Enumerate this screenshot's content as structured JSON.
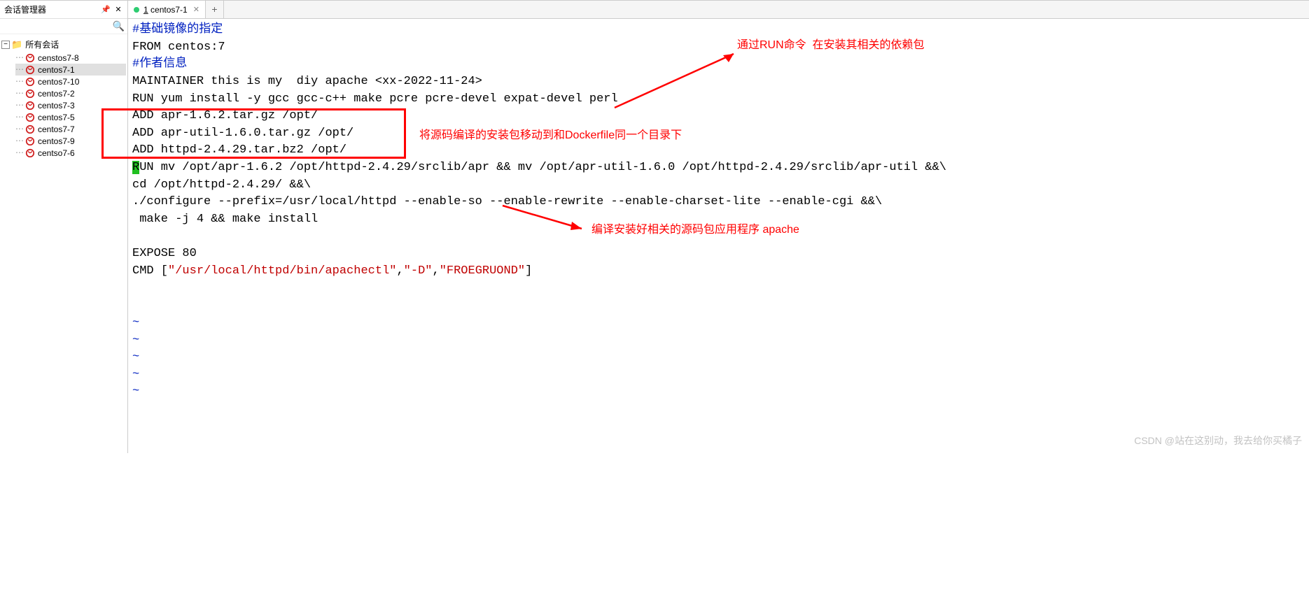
{
  "sidebar": {
    "title": "会话管理器",
    "root_label": "所有会话",
    "items": [
      {
        "label": "censtos7-8"
      },
      {
        "label": "centos7-1"
      },
      {
        "label": "centos7-10"
      },
      {
        "label": "centos7-2"
      },
      {
        "label": "centos7-3"
      },
      {
        "label": "centos7-5"
      },
      {
        "label": "centos7-7"
      },
      {
        "label": "centos7-9"
      },
      {
        "label": "centso7-6"
      }
    ]
  },
  "tabs": {
    "active_num": "1",
    "active_label": "centos7-1",
    "add": "+"
  },
  "code": {
    "l1": "#基础镜像的指定",
    "l2": "FROM centos:7",
    "l3": "#作者信息",
    "l4": "MAINTAINER this is my  diy apache <xx-2022-11-24>",
    "l5": "RUN yum install -y gcc gcc-c++ make pcre pcre-devel expat-devel perl",
    "l6": "ADD apr-1.6.2.tar.gz /opt/",
    "l7": "ADD apr-util-1.6.0.tar.gz /opt/",
    "l8": "ADD httpd-2.4.29.tar.bz2 /opt/",
    "l9a": "R",
    "l9b": "UN mv /opt/apr-1.6.2 /opt/httpd-2.4.29/srclib/apr && mv /opt/apr-util-1.6.0 /opt/httpd-2.4.29/srclib/apr-util &&\\",
    "l10": "cd /opt/httpd-2.4.29/ &&\\",
    "l11": "./configure --prefix=/usr/local/httpd --enable-so --enable-rewrite --enable-charset-lite --enable-cgi &&\\",
    "l12": " make -j 4 && make install",
    "l13": "",
    "l14": "EXPOSE 80",
    "l15a": "CMD [",
    "l15b": "\"/usr/local/httpd/bin/apachectl\"",
    "l15c": ",",
    "l15d": "\"-D\"",
    "l15e": ",",
    "l15f": "\"FROEGRUOND\"",
    "l15g": "]",
    "tilde": "~"
  },
  "annotations": {
    "a1": "通过RUN命令  在安装其相关的依赖包",
    "a2": "将源码编译的安装包移动到和Dockerfile同一个目录下",
    "a3": "编译安装好相关的源码包应用程序 apache"
  },
  "watermark": "CSDN @站在这别动，我去给你买橘子"
}
